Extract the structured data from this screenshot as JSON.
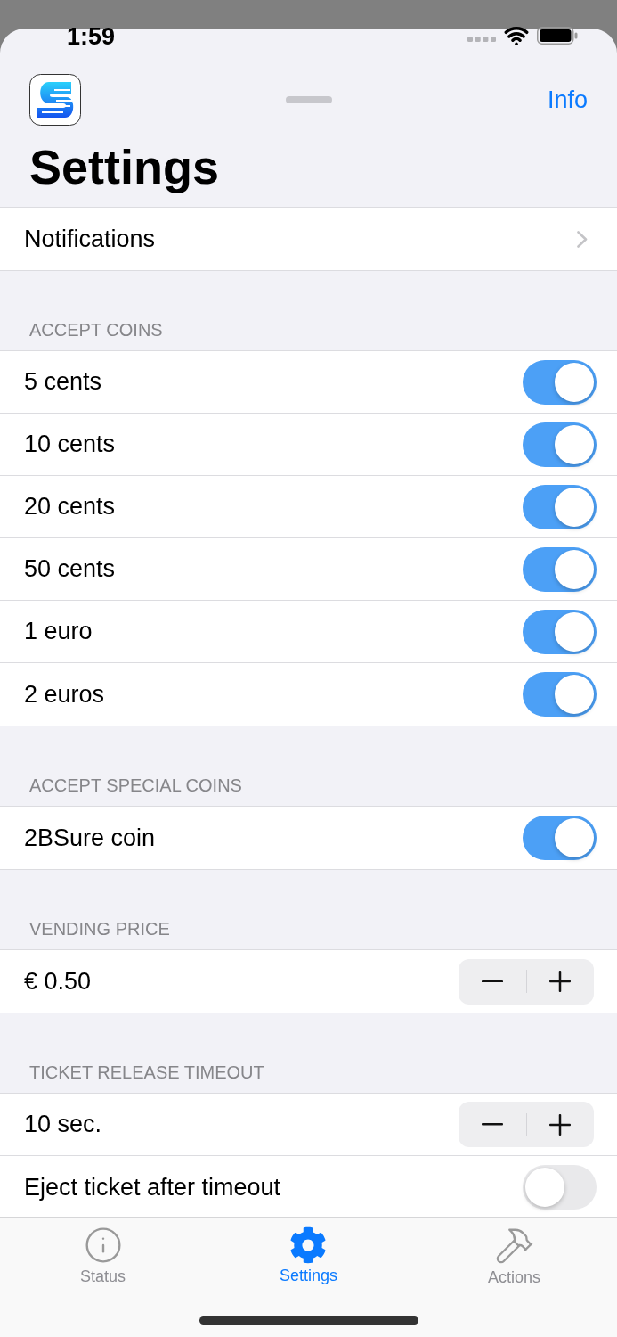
{
  "status_bar": {
    "time": "1:59"
  },
  "header": {
    "action": "Info",
    "title": "Settings"
  },
  "sections": [
    {
      "rows": [
        {
          "kind": "link",
          "label": "Notifications"
        }
      ]
    },
    {
      "header": "ACCEPT COINS",
      "rows": [
        {
          "kind": "toggle",
          "label": "5 cents",
          "on": true
        },
        {
          "kind": "toggle",
          "label": "10 cents",
          "on": true
        },
        {
          "kind": "toggle",
          "label": "20 cents",
          "on": true
        },
        {
          "kind": "toggle",
          "label": "50 cents",
          "on": true
        },
        {
          "kind": "toggle",
          "label": "1 euro",
          "on": true
        },
        {
          "kind": "toggle",
          "label": "2 euros",
          "on": true
        }
      ]
    },
    {
      "header": "ACCEPT SPECIAL COINS",
      "rows": [
        {
          "kind": "toggle",
          "label": "2BSure coin",
          "on": true
        }
      ]
    },
    {
      "header": "VENDING PRICE",
      "rows": [
        {
          "kind": "stepper",
          "label": "€ 0.50"
        }
      ]
    },
    {
      "header": "TICKET RELEASE TIMEOUT",
      "rows": [
        {
          "kind": "stepper",
          "label": "10 sec."
        },
        {
          "kind": "toggle",
          "label": "Eject ticket after timeout",
          "on": false
        }
      ]
    }
  ],
  "tab_bar": [
    {
      "label": "Status",
      "selected": false
    },
    {
      "label": "Settings",
      "selected": true
    },
    {
      "label": "Actions",
      "selected": false
    }
  ]
}
